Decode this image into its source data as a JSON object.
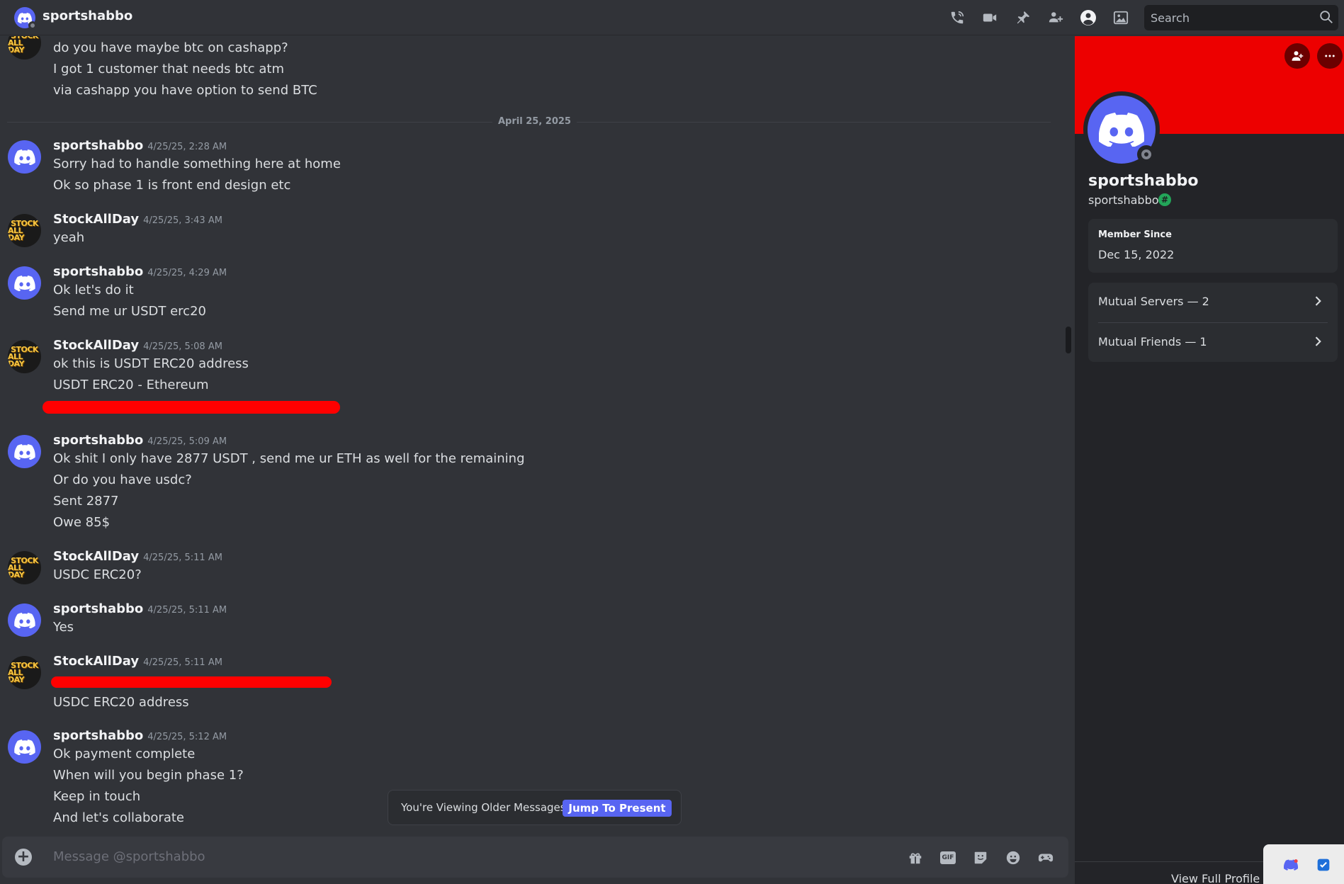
{
  "topbar": {
    "title": "sportshabbo",
    "search_placeholder": "Search",
    "icons": [
      "phone-call-icon",
      "video-call-icon",
      "pin-icon",
      "add-friends-icon",
      "user-profile-icon",
      "media-icon",
      "search-icon"
    ]
  },
  "chat": {
    "partial_lines": [
      "do you have maybe btc on cashapp?",
      "I got 1 customer that needs btc atm",
      "via cashapp you have option to send BTC"
    ],
    "date_divider": "April 25, 2025",
    "messages": [
      {
        "author": "sportshabbo",
        "time": "4/25/25, 2:28 AM",
        "lines": [
          "Sorry had to handle something here at home",
          "Ok so phase 1 is front end design etc"
        ]
      },
      {
        "author": "StockAllDay",
        "time": "4/25/25, 3:43 AM",
        "lines": [
          "yeah"
        ]
      },
      {
        "author": "sportshabbo",
        "time": "4/25/25, 4:29 AM",
        "lines": [
          "Ok let's do it",
          "Send me ur USDT erc20"
        ]
      },
      {
        "author": "StockAllDay",
        "time": "4/25/25, 5:08 AM",
        "lines": [
          "ok this is USDT ERC20 address",
          "USDT ERC20 - Ethereum"
        ]
      },
      {
        "author": "sportshabbo",
        "time": "4/25/25, 5:09 AM",
        "lines": [
          "Ok shit I only have 2877 USDT , send me ur ETH as well for the remaining",
          "Or do you have usdc?",
          "Sent 2877",
          "Owe 85$"
        ]
      },
      {
        "author": "StockAllDay",
        "time": "4/25/25, 5:11 AM",
        "lines": [
          "USDC ERC20?"
        ]
      },
      {
        "author": "sportshabbo",
        "time": "4/25/25, 5:11 AM",
        "lines": [
          "Yes"
        ]
      },
      {
        "author": "StockAllDay",
        "time": "4/25/25, 5:11 AM",
        "lines": [
          "USDC ERC20 address"
        ]
      },
      {
        "author": "sportshabbo",
        "time": "4/25/25, 5:12 AM",
        "lines": [
          "Ok payment complete",
          "When will you begin phase 1?",
          "Keep in touch",
          "And let's collaborate"
        ]
      }
    ],
    "stock_avatar_text": [
      "STOCK",
      "ALL DAY"
    ],
    "older_banner": {
      "text": "You're Viewing Older Messages",
      "button": "Jump To Present"
    }
  },
  "composer": {
    "placeholder": "Message @sportshabbo",
    "gif_label": "GIF",
    "icons": [
      "add-attachment-icon",
      "gift-icon",
      "gif-icon",
      "sticker-icon",
      "emoji-icon",
      "activities-icon"
    ]
  },
  "profile": {
    "display_name": "sportshabbo",
    "username": "sportshabbo",
    "badge": "#",
    "member_since_label": "Member Since",
    "member_since_value": "Dec 15, 2022",
    "mutual_servers": "Mutual Servers — 2",
    "mutual_friends": "Mutual Friends — 1",
    "view_full_profile": "View Full Profile",
    "banner_color": "#ed0000"
  },
  "colors": {
    "accent": "#5865f2",
    "background": "#313338",
    "redaction": "#ff0000"
  }
}
